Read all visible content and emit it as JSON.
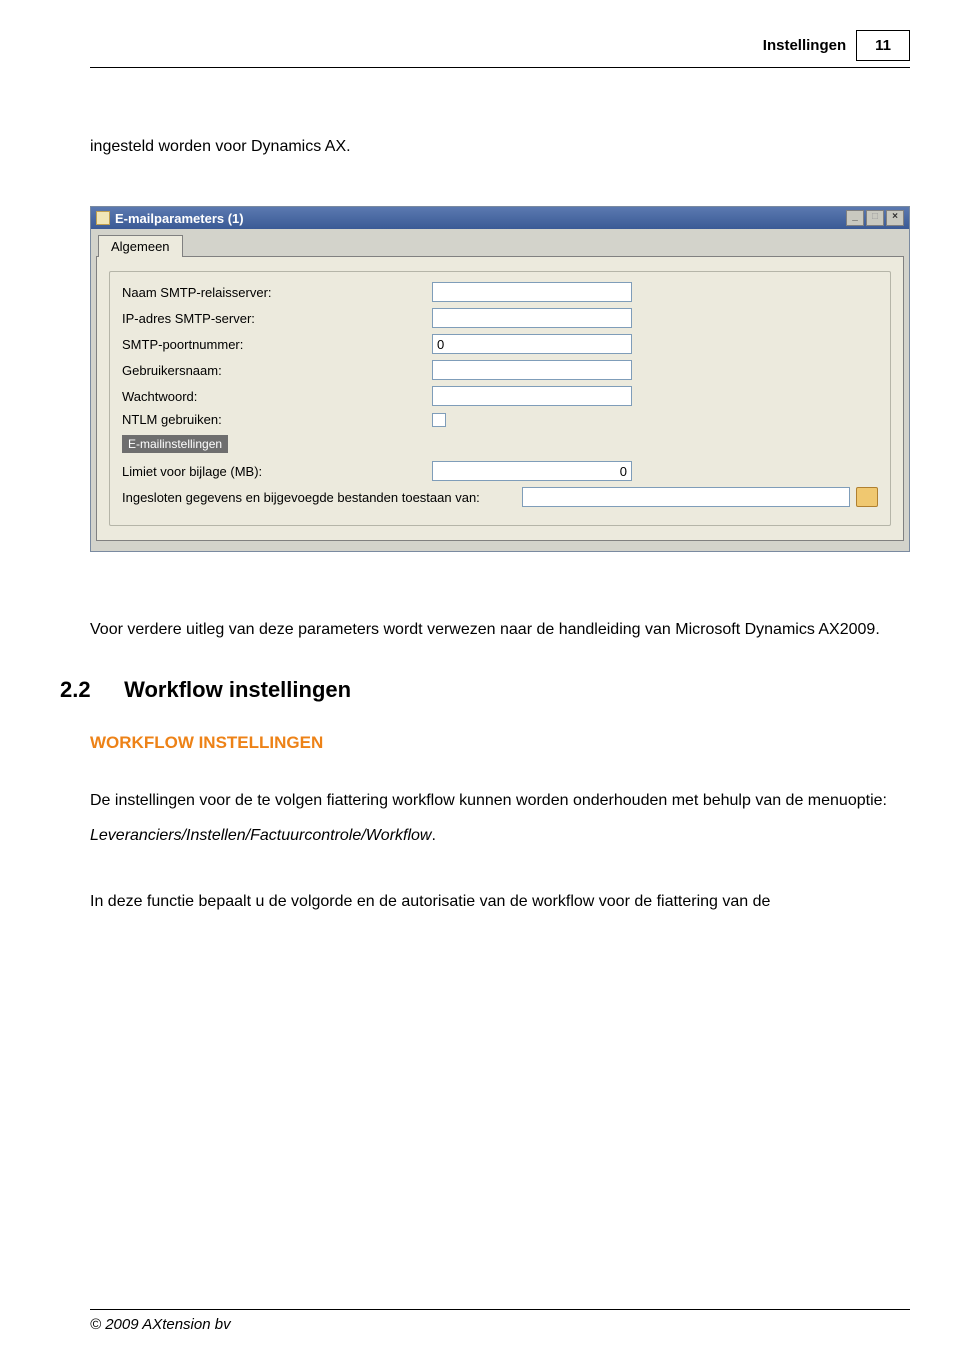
{
  "header": {
    "title": "Instellingen",
    "page_number": "11"
  },
  "intro": "ingesteld worden voor Dynamics AX.",
  "window": {
    "title": "E-mailparameters (1)",
    "tabs": [
      {
        "label": "Algemeen"
      }
    ],
    "fields": {
      "smtp_relay_label": "Naam SMTP-relaisserver:",
      "smtp_relay_value": "",
      "ip_label": "IP-adres SMTP-server:",
      "ip_value": "",
      "port_label": "SMTP-poortnummer:",
      "port_value": "0",
      "user_label": "Gebruikersnaam:",
      "user_value": "",
      "pass_label": "Wachtwoord:",
      "pass_value": "",
      "ntlm_label": "NTLM gebruiken:",
      "group_label": "E-mailinstellingen",
      "limit_label": "Limiet voor bijlage (MB):",
      "limit_value": "0",
      "allow_label": "Ingesloten gegevens en bijgevoegde bestanden toestaan van:",
      "allow_value": ""
    }
  },
  "para1": "Voor verdere uitleg van deze parameters wordt verwezen naar de handleiding van Microsoft Dynamics AX2009.",
  "section": {
    "number": "2.2",
    "title": "Workflow instellingen"
  },
  "subheading": "WORKFLOW INSTELLINGEN",
  "para2_a": "De instellingen voor de te volgen fiattering workflow kunnen worden onderhouden met behulp van de menuoptie: ",
  "para2_b": "Leveranciers/Instellen/Factuurcontrole/Workflow",
  "para2_c": ".",
  "para3": "In deze functie bepaalt u de volgorde en de autorisatie van de workflow voor de fiattering van de",
  "footer": "© 2009 AXtension bv"
}
